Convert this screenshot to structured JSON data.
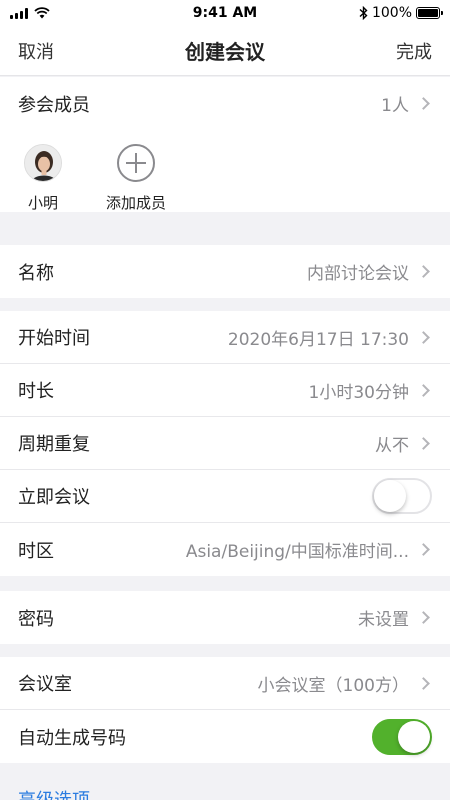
{
  "status_bar": {
    "time": "9:41 AM",
    "battery": "100%"
  },
  "nav": {
    "cancel": "取消",
    "title": "创建会议",
    "done": "完成"
  },
  "participants": {
    "label": "参会成员",
    "count": "1人",
    "members": [
      {
        "name": "小明"
      }
    ],
    "add_label": "添加成员"
  },
  "name_row": {
    "label": "名称",
    "value": "内部讨论会议"
  },
  "schedule": {
    "start": {
      "label": "开始时间",
      "value": "2020年6月17日 17:30"
    },
    "duration": {
      "label": "时长",
      "value": "1小时30分钟"
    },
    "repeat": {
      "label": "周期重复",
      "value": "从不"
    },
    "instant": {
      "label": "立即会议",
      "enabled": false
    },
    "timezone": {
      "label": "时区",
      "value": "Asia/Beijing/中国标准时间..."
    }
  },
  "password": {
    "label": "密码",
    "value": "未设置"
  },
  "room": {
    "room": {
      "label": "会议室",
      "value": "小会议室（100方）"
    },
    "auto_number": {
      "label": "自动生成号码",
      "enabled": true
    }
  },
  "advanced": {
    "label": "高级选项"
  },
  "colors": {
    "accent_green": "#52b12c",
    "link_blue": "#2b7ce0",
    "background": "#f2f2f5"
  }
}
